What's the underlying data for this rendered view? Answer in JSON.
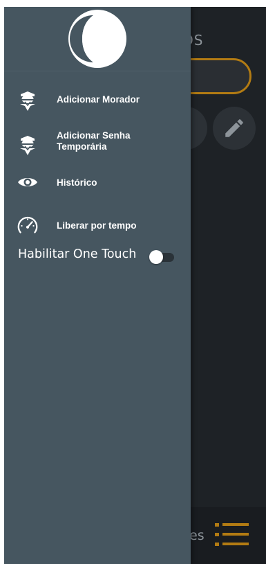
{
  "background": {
    "title_fragment": "OS",
    "bottom_label_fragment": "es",
    "accent_color": "#b27b13"
  },
  "drawer": {
    "logo": "half-moon-logo",
    "items": [
      {
        "label": "Adicionar Morador",
        "icon": "resident-icon"
      },
      {
        "label": "Adicionar Senha Temporária",
        "icon": "resident-icon"
      },
      {
        "label": "Histórico",
        "icon": "eye-icon"
      },
      {
        "label": "Liberar por tempo",
        "icon": "speedometer-icon"
      }
    ],
    "toggle": {
      "label": "Habilitar One Touch",
      "enabled": false
    }
  },
  "colors": {
    "drawer_bg": "#465660",
    "screen_bg": "#1e2226",
    "text": "#ffffff"
  }
}
